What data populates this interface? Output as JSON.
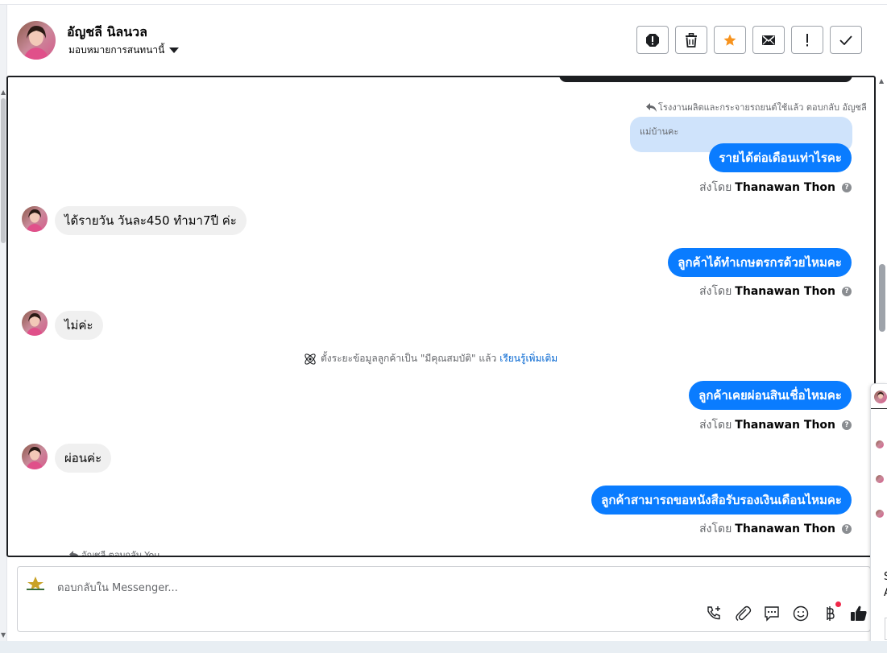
{
  "header": {
    "contact_name": "อัญชลี นิลนวล",
    "assign_label": "มอบหมายการสนทนานี้",
    "actions": [
      {
        "icon": "spam-alert-icon"
      },
      {
        "icon": "trash-icon"
      },
      {
        "icon": "star-icon"
      },
      {
        "icon": "mail-icon"
      },
      {
        "icon": "exclamation-icon"
      },
      {
        "icon": "check-icon"
      }
    ]
  },
  "conversation": {
    "reply_note_top": "โรงงานผลิตและกระจายรถยนต์ใช้แล้ว ตอบกลับ อัญชลี",
    "quoted_text": "แม่บ้านคะ",
    "messages": [
      {
        "direction": "out",
        "text": "รายได้ต่อเดือนเท่าไรคะ",
        "sent_by_prefix": "ส่งโดย",
        "sender": "Thanawan Thon"
      },
      {
        "direction": "in",
        "text": "ได้รายวัน วันละ450 ทำมา7ปี ค่ะ"
      },
      {
        "direction": "out",
        "text": "ลูกค้าได้ทำเกษตรกรด้วยไหมคะ",
        "sent_by_prefix": "ส่งโดย",
        "sender": "Thanawan Thon"
      },
      {
        "direction": "in",
        "text": "ไม่ค่ะ"
      },
      {
        "direction": "out",
        "text": "ลูกค้าเคยผ่อนสินเชื่อไหมคะ",
        "sent_by_prefix": "ส่งโดย",
        "sender": "Thanawan Thon"
      },
      {
        "direction": "in",
        "text": "ผ่อนค่ะ"
      },
      {
        "direction": "out",
        "text": "ลูกค้าสามารถขอหนังสือรับรองเงินเดือนไหมคะ",
        "sent_by_prefix": "ส่งโดย",
        "sender": "Thanawan Thon"
      }
    ],
    "system_note": {
      "text": "ตั้งระยะข้อมูลลูกค้าเป็น \"มีคุณสมบัติ\" แล้ว",
      "link": "เรียนรู้เพิ่มเติม"
    },
    "reply_note_bottom": "อัญชลี ตอบกลับ You"
  },
  "composer": {
    "placeholder": "ตอบกลับใน Messenger...",
    "tools": [
      "call-add-icon",
      "attachment-icon",
      "saved-reply-icon",
      "emoji-icon",
      "baht-payment-icon",
      "thumbs-up-icon"
    ]
  },
  "side_panel": {
    "letters": "S\nA"
  },
  "colors": {
    "outgoing_bubble": "#0a7cff",
    "incoming_bubble": "#f0f0f0",
    "quoted_bubble": "#cfe3fb",
    "star": "#f7931e",
    "link": "#0064d1",
    "notification_dot": "#f02849"
  }
}
